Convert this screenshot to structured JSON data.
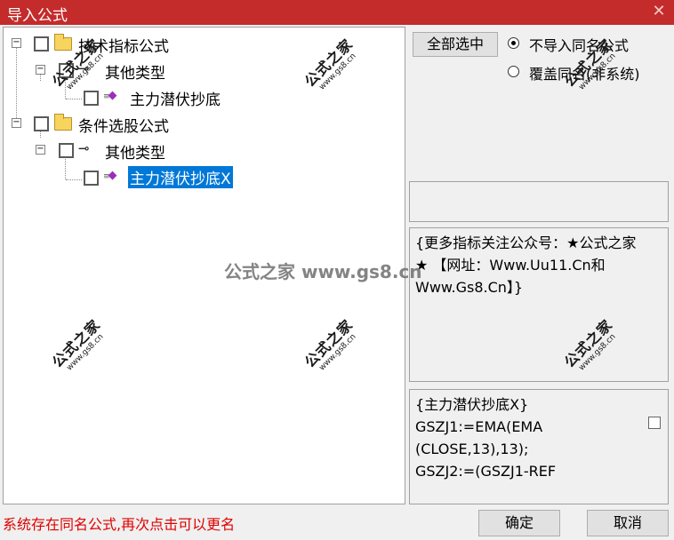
{
  "window": {
    "title": "导入公式",
    "close_glyph": "✕"
  },
  "tree": {
    "nodes": [
      {
        "label": "技术指标公式",
        "icon": "folder-icon"
      },
      {
        "label": "其他类型",
        "icon": "key-icon"
      },
      {
        "label": "主力潜伏抄底",
        "icon": "formula-gem-icon"
      },
      {
        "label": "条件选股公式",
        "icon": "folder-icon"
      },
      {
        "label": "其他类型",
        "icon": "key-icon"
      },
      {
        "label": "主力潜伏抄底X",
        "icon": "formula-gem-icon",
        "selected": true
      }
    ],
    "expand_glyph": "−"
  },
  "options": {
    "select_all_label": "全部选中",
    "radio_no_import": "不导入同名公式",
    "radio_overwrite": "覆盖同名(非系统)",
    "selected": "no_import"
  },
  "info_text": "{更多指标关注公众号：★公式之家★ 【网址：Www.Uu11.Cn和Www.Gs8.Cn】}",
  "code_text": "{主力潜伏抄底X}\nGSZJ1:=EMA(EMA\n(CLOSE,13),13);\nGSZJ2:=(GSZJ1-REF",
  "status_text": "系统存在同名公式,再次点击可以更名",
  "buttons": {
    "ok": "确定",
    "cancel": "取消"
  },
  "watermark": {
    "main": "公式之家",
    "url": "www.gs8.cn",
    "center": "公式之家 www.gs8.cn"
  },
  "colors": {
    "titlebar": "#c42b2b",
    "selection": "#0078d7",
    "status": "#e00000"
  }
}
